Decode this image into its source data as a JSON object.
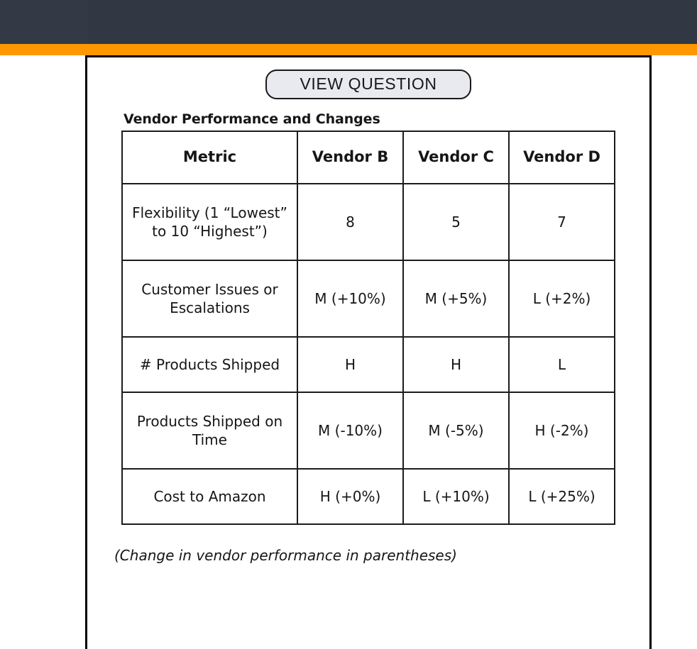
{
  "chrome": {
    "top_bar_color": "#313844",
    "accent_bar_color": "#ff9800"
  },
  "panel": {
    "view_question_label": "VIEW QUESTION",
    "table_caption": "Vendor Performance and Changes",
    "footnote": "(Change in vendor performance in parentheses)"
  },
  "chart_data": {
    "type": "table",
    "title": "Vendor Performance and Changes",
    "columns": [
      "Metric",
      "Vendor B",
      "Vendor C",
      "Vendor D"
    ],
    "column_lines": [
      [
        "Metric",
        ""
      ],
      [
        "Vendor",
        "B"
      ],
      [
        "Vendor",
        "C"
      ],
      [
        "Vendor",
        "D"
      ]
    ],
    "rows": [
      {
        "metric_lines": [
          "Flexibility",
          "(1 “Lowest” to",
          "10 “Highest”)"
        ],
        "metric": "Flexibility (1 “Lowest” to 10 “Highest”)",
        "vendor_b": "8",
        "vendor_b_change": "",
        "vendor_c": "5",
        "vendor_c_change": "",
        "vendor_d": "7",
        "vendor_d_change": ""
      },
      {
        "metric_lines": [
          "Customer",
          "Issues or",
          "Escalations"
        ],
        "metric": "Customer Issues or Escalations",
        "vendor_b": "M",
        "vendor_b_change": "(+10%)",
        "vendor_c": "M",
        "vendor_c_change": "(+5%)",
        "vendor_d": "L",
        "vendor_d_change": "(+2%)"
      },
      {
        "metric_lines": [
          "# Products",
          "Shipped"
        ],
        "metric": "# Products Shipped",
        "vendor_b": "H",
        "vendor_b_change": "",
        "vendor_c": "H",
        "vendor_c_change": "",
        "vendor_d": "L",
        "vendor_d_change": ""
      },
      {
        "metric_lines": [
          "Products",
          "Shipped on",
          "Time"
        ],
        "metric": "Products Shipped on Time",
        "vendor_b": "M",
        "vendor_b_change": "(-10%)",
        "vendor_c": "M",
        "vendor_c_change": "(-5%)",
        "vendor_d": "H",
        "vendor_d_change": "(-2%)"
      },
      {
        "metric_lines": [
          "Cost to",
          "Amazon"
        ],
        "metric": "Cost to Amazon",
        "vendor_b": "H",
        "vendor_b_change": "(+0%)",
        "vendor_c": "L",
        "vendor_c_change": "(+10%)",
        "vendor_d": "L",
        "vendor_d_change": "(+25%)"
      }
    ],
    "footnote": "(Change in vendor performance in parentheses)"
  }
}
